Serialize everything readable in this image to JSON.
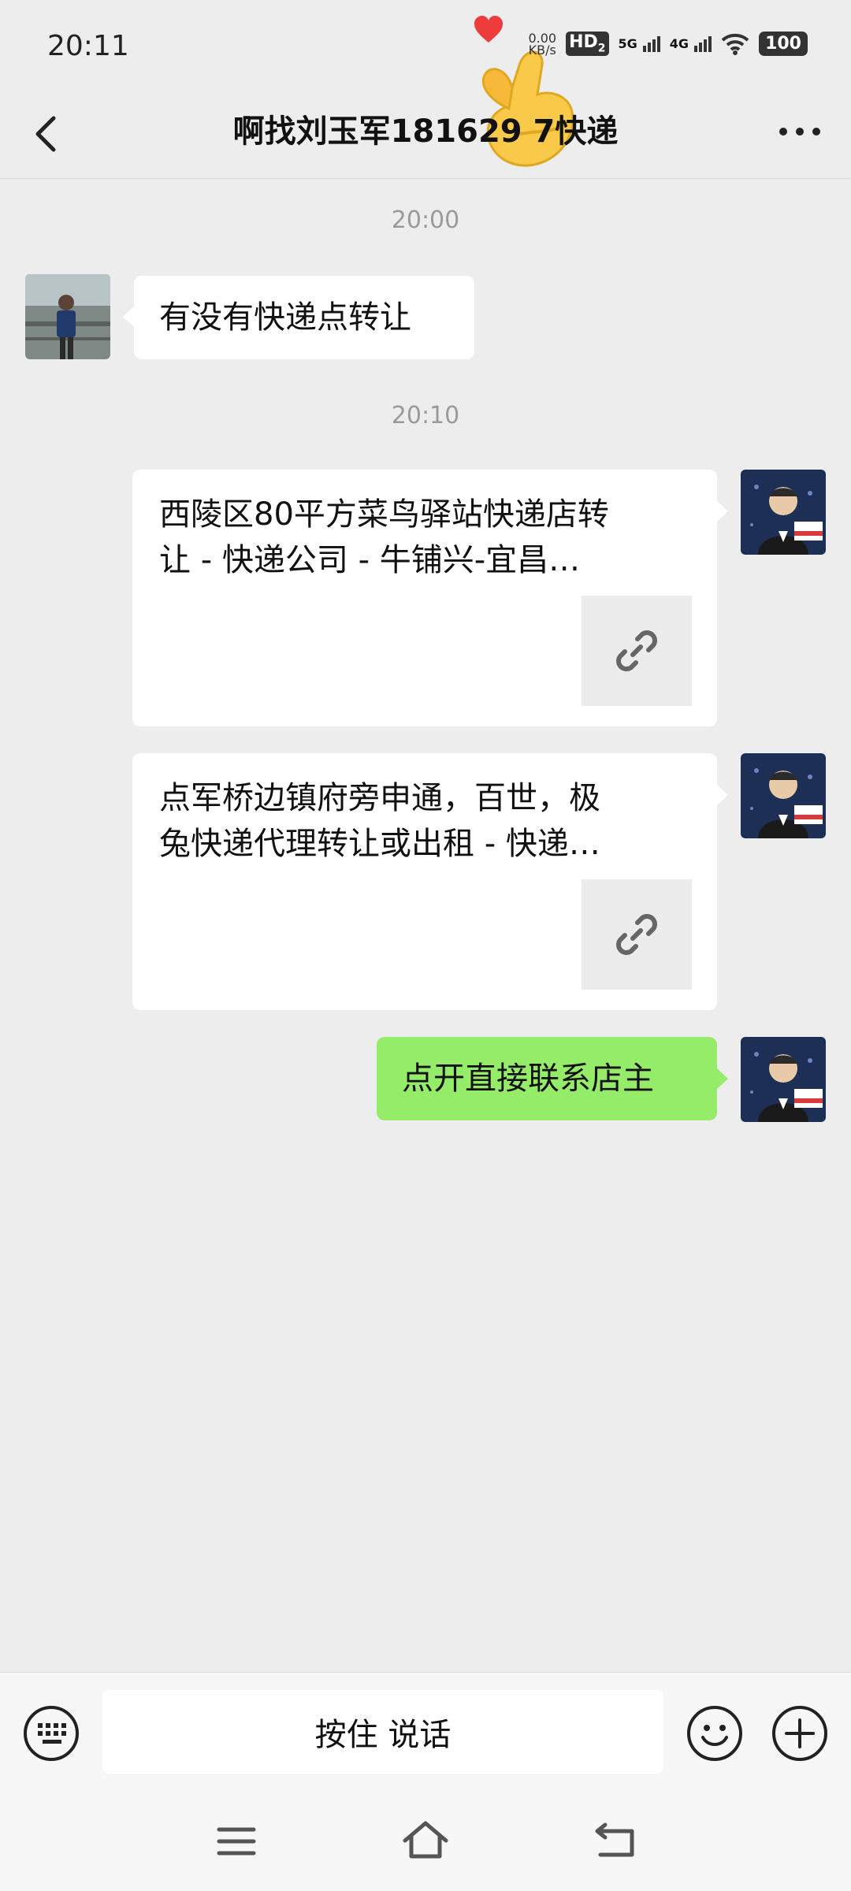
{
  "status_bar": {
    "time": "20:11",
    "net_speed_value": "0.00",
    "net_speed_unit": "KB/s",
    "hd_badge": "HD",
    "hd_sub": "2",
    "signal_5g": "5G",
    "signal_4g": "4G",
    "battery": "100"
  },
  "header": {
    "title": "啊找刘玉军181629    7快递"
  },
  "messages": [
    {
      "type": "timestamp",
      "text": "20:00"
    },
    {
      "type": "text",
      "side": "left",
      "text": "有没有快递点转让"
    },
    {
      "type": "timestamp",
      "text": "20:10"
    },
    {
      "type": "link",
      "side": "right",
      "line1": "西陵区80平方菜鸟驿站快递店转",
      "line2": "让 - 快递公司 - 牛铺兴-宜昌…"
    },
    {
      "type": "link",
      "side": "right",
      "line1": "点军桥边镇府旁申通，百世，极",
      "line2": "兔快递代理转让或出租 - 快递…"
    },
    {
      "type": "text",
      "side": "right",
      "text": "点开直接联系店主"
    }
  ],
  "input_bar": {
    "voice_button_label": "按住 说话"
  },
  "icons": {
    "back": "chevron-left-icon",
    "more": "more-dots-icon",
    "link": "link-icon",
    "keyboard": "keyboard-icon",
    "emoji": "emoji-icon",
    "add": "plus-circle-icon",
    "nav_menu": "menu-icon",
    "nav_home": "home-icon",
    "nav_back": "back-arrow-icon"
  },
  "colors": {
    "background": "#ededed",
    "bubble_received": "#ffffff",
    "bubble_sent": "#95ec69",
    "timestamp": "#9a9a9a"
  }
}
